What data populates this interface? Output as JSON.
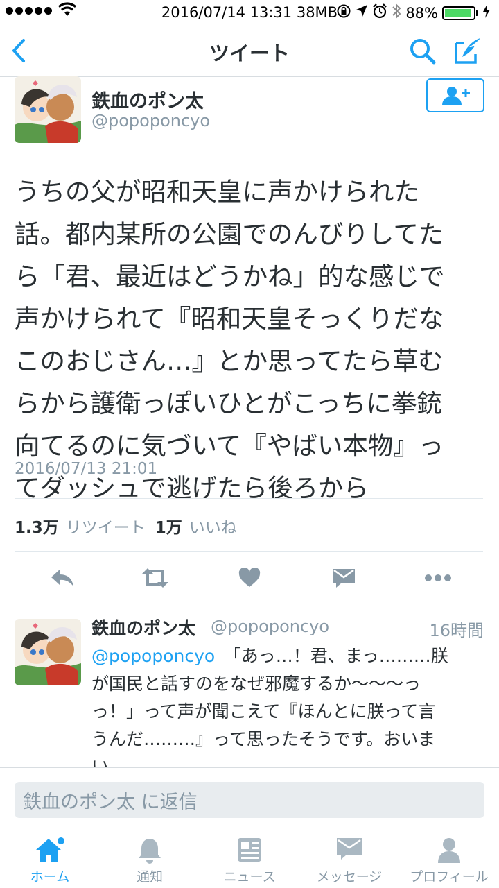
{
  "status_bar": {
    "time": "2016/07/14 13:31 38MB",
    "battery": "88%",
    "battery_level": 0.88
  },
  "nav": {
    "title": "ツイート",
    "back_icon": "chevron-left-icon",
    "search_icon": "search-icon",
    "compose_icon": "compose-icon"
  },
  "tweet": {
    "author_name": "鉄血のポン太",
    "author_handle": "@popoponcyo",
    "text_lines": [
      "うちの父が昭和天皇に声かけられた",
      "話。都内某所の公園でのんびりしてた",
      "ら「君、最近はどうかね」的な感じで",
      "声かけられて『昭和天皇そっくりだな",
      "このおじさん…』とか思ってたら草む",
      "らから護衛っぽいひとがこっちに拳銃",
      "向てるのに気づいて『やばい本物』っ",
      "てダッシュで逃げたら後ろから"
    ],
    "date": "2016/07/13 21:01",
    "retweet_count": "1.3万",
    "retweet_label": "リツイート",
    "like_count": "1万",
    "like_label": "いいね"
  },
  "reply": {
    "author_name": "鉄血のポン太",
    "author_handle": "@popoponcyo",
    "time": "16時間",
    "mention": "@popoponcyo",
    "text_first": "　「あっ…！君、まっ………朕",
    "text_rest": [
      "が国民と話すのをなぜ邪魔するか〜〜〜っ",
      "っ！」って声が聞こえて『ほんとに朕って言",
      "うんだ………』って思ったそうです。おいま",
      "い。"
    ]
  },
  "reply_bar": {
    "placeholder": "鉄血のポン太 に返信"
  },
  "tabs": [
    {
      "label": "ホーム",
      "icon": "home-icon",
      "active": true
    },
    {
      "label": "通知",
      "icon": "bell-icon",
      "active": false
    },
    {
      "label": "ニュース",
      "icon": "news-icon",
      "active": false
    },
    {
      "label": "メッセージ",
      "icon": "envelope-icon",
      "active": false
    },
    {
      "label": "プロフィール",
      "icon": "profile-icon",
      "active": false
    }
  ],
  "colors": {
    "accent": "#1da1f2",
    "muted": "#8899a6",
    "text": "#292f33"
  }
}
